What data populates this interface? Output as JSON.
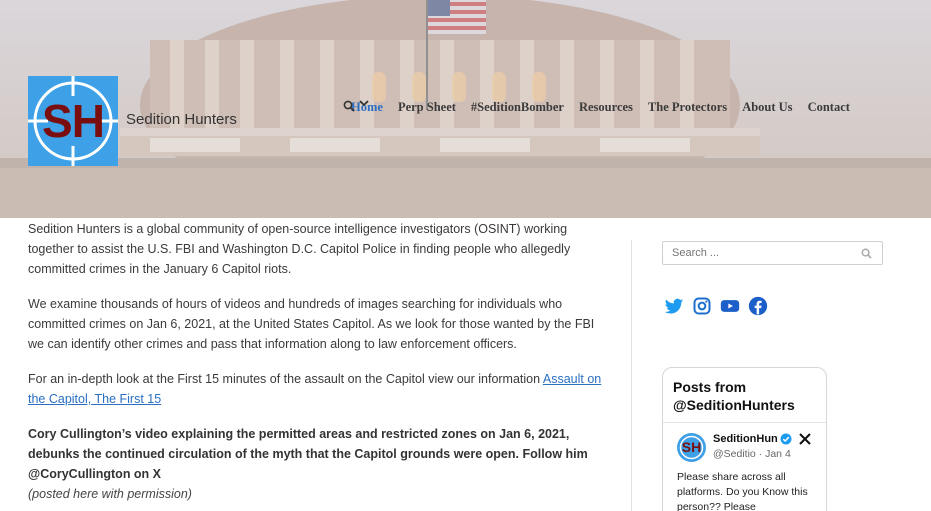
{
  "site": {
    "title": "Sedition Hunters",
    "logo_text": "SH"
  },
  "nav": {
    "items": [
      {
        "label": "Home",
        "active": true
      },
      {
        "label": "Perp Sheet"
      },
      {
        "label": "#SeditionBomber"
      },
      {
        "label": "Resources",
        "has_dropdown": true
      },
      {
        "label": "The Protectors"
      },
      {
        "label": "About Us"
      },
      {
        "label": "Contact"
      }
    ],
    "search_icon": "search-icon"
  },
  "content": {
    "p1": "Sedition Hunters is a global community of open-source intelligence investigators (OSINT) working together to assist the U.S. FBI and Washington D.C. Capitol Police in finding people who allegedly committed crimes in the January 6 Capitol riots.",
    "p2": "We examine thousands of hours of videos and hundreds of images searching for individuals who committed crimes on Jan 6, 2021, at the United States Capitol. As we look for those wanted by the FBI we can identify other crimes and pass that information along to law enforcement officers.",
    "p3_text": "For an in-depth look at the First 15 minutes of the assault on the Capitol view our information ",
    "p3_link": "Assault on the Capitol, The First 15",
    "p4_bold": "Cory Cullington’s video explaining the permitted areas and restricted zones on Jan 6, 2021, debunks the continued circulation of the myth that the Capitol grounds were open. Follow him @CoryCullington on X",
    "p4_italic": "(posted here with permission)"
  },
  "sidebar": {
    "search_placeholder": "Search ...",
    "socials": [
      "twitter-icon",
      "instagram-icon",
      "youtube-icon",
      "facebook-icon"
    ],
    "feed": {
      "title": "Posts from @SeditionHunters",
      "post": {
        "avatar_text": "SH",
        "name": "SeditionHunters",
        "handle": "@Seditio · Jan 4",
        "text": "Please share across all platforms. Do you Know this person?? Please"
      }
    }
  },
  "colors": {
    "accent": "#2a6fc2",
    "logo_bg": "#3ea0e6",
    "logo_text": "#7a0e0e"
  }
}
